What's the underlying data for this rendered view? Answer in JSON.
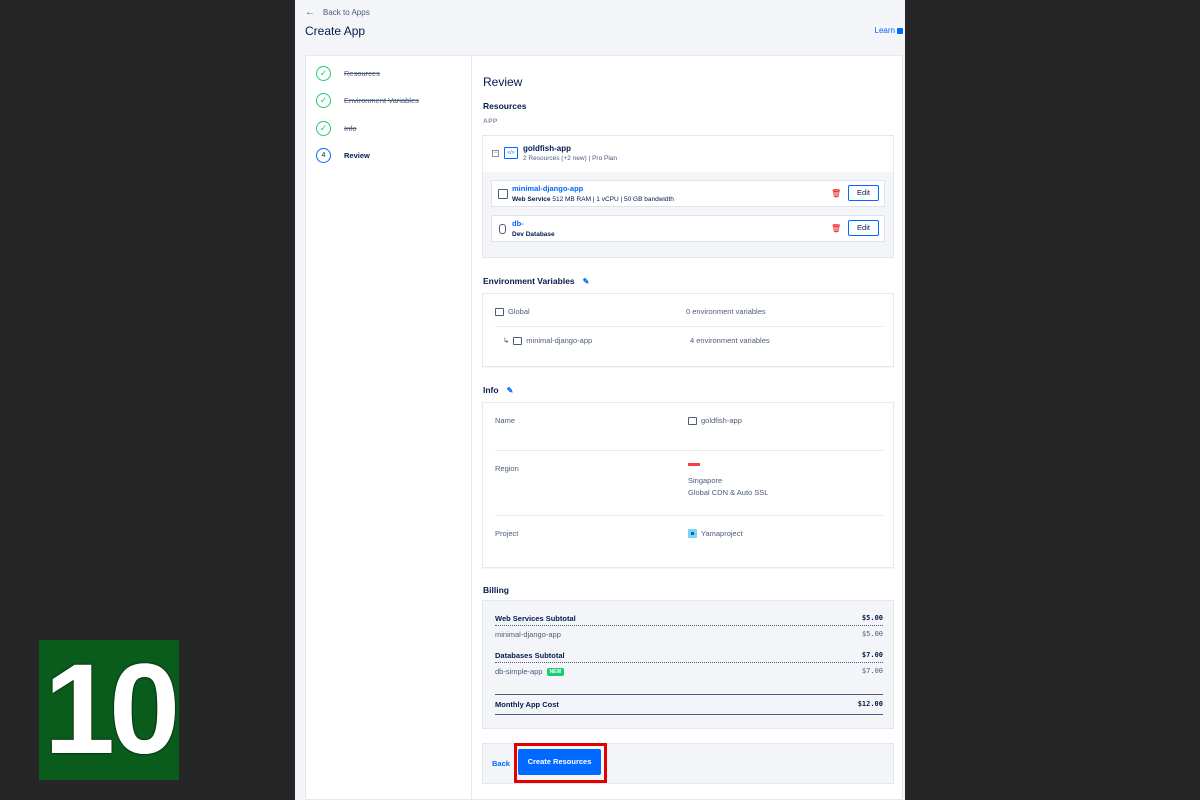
{
  "header": {
    "back_label": "Back to Apps",
    "title": "Create App",
    "learn_label": "Learn"
  },
  "steps": [
    {
      "label": "Resources",
      "state": "done"
    },
    {
      "label": "Environment Variables",
      "state": "done"
    },
    {
      "label": "Info",
      "state": "done"
    },
    {
      "label": "Review",
      "state": "active",
      "number": "4"
    }
  ],
  "review": {
    "title": "Review",
    "resources_heading": "Resources",
    "app_label": "APP",
    "app": {
      "name": "goldfish-app",
      "summary": "2 Resources (+2 new) | Pro Plan",
      "collapse": "−",
      "icon_text": "</>"
    },
    "resources": [
      {
        "name": "minimal-django-app",
        "type": "Web Service",
        "spec": " 512 MB RAM | 1 vCPU | 50 GB bandwidth",
        "edit": "Edit"
      },
      {
        "name": "db-",
        "type": "Dev Database",
        "spec": "",
        "edit": "Edit"
      }
    ]
  },
  "env": {
    "heading": "Environment Variables",
    "rows": [
      {
        "name": "Global",
        "value": "0 environment variables"
      },
      {
        "name": "minimal-django-app",
        "value": "4 environment variables"
      }
    ],
    "child_arrow": "↳"
  },
  "info": {
    "heading": "Info",
    "name_label": "Name",
    "name_value": "goldfish-app",
    "region_label": "Region",
    "region_value": "Singapore",
    "region_extra": "Global CDN & Auto SSL",
    "project_label": "Project",
    "project_value": "Yamaproject"
  },
  "billing": {
    "heading": "Billing",
    "web_subtotal_label": "Web Services Subtotal",
    "web_subtotal": "$5.00",
    "web_item": "minimal-django-app",
    "web_item_amt": "$5.00",
    "db_subtotal_label": "Databases Subtotal",
    "db_subtotal": "$7.00",
    "db_item": "db-simple-app",
    "db_item_badge": "NEW",
    "db_item_amt": "$7.00",
    "monthly_label": "Monthly App Cost",
    "monthly": "$12.00"
  },
  "footer": {
    "back_label": "Back",
    "create_label": "Create Resources"
  },
  "overlay": {
    "step_number": "10"
  },
  "colors": {
    "accent": "#0069ff",
    "success": "#15cd72",
    "danger": "#e50000",
    "badge_bg": "#0a5c1c"
  },
  "icons": {
    "check": "✓",
    "trash": "🗑",
    "pencil": "✎",
    "back_arrow": "←"
  }
}
